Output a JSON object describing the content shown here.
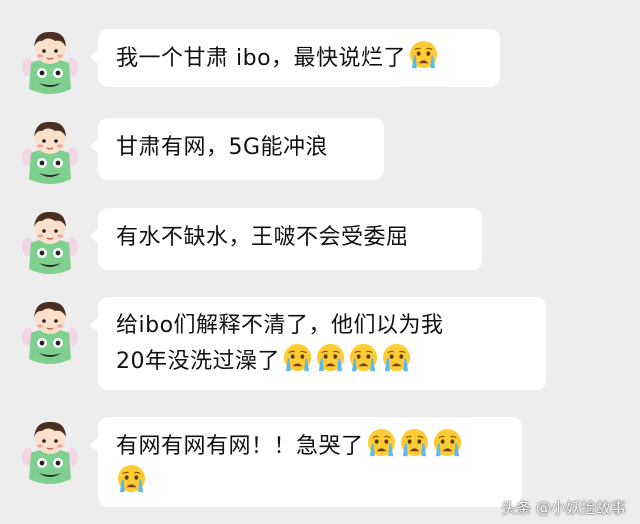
{
  "colors": {
    "background": "#ededed",
    "bubble": "#ffffff",
    "text": "#111111"
  },
  "messages": [
    {
      "lines": [
        "我一个甘肃 ibo，最快说烂了"
      ],
      "emoji_after_line": [
        1
      ]
    },
    {
      "lines": [
        "甘肃有网，5G能冲浪"
      ],
      "emoji_after_line": [
        0
      ]
    },
    {
      "lines": [
        "有水不缺水，王啵不会受委屈"
      ],
      "emoji_after_line": [
        0
      ]
    },
    {
      "lines": [
        "给ibo们解释不清了，他们以为我",
        "20年没洗过澡了"
      ],
      "emoji_after_line": [
        0,
        4
      ]
    },
    {
      "lines": [
        "有网有网有网！！急哭了",
        ""
      ],
      "emoji_after_line": [
        3,
        1
      ]
    }
  ],
  "icons": {
    "avatar": "cartoon-avatar-icon",
    "emoji": "crying-face-emoji-icon"
  },
  "watermark": "头条 @小妖捡故事"
}
